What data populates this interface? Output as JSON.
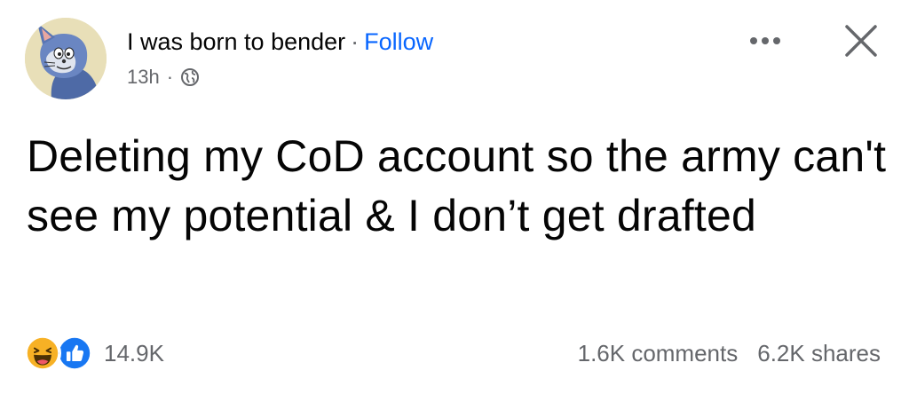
{
  "post": {
    "author": {
      "name": "I was born to bender",
      "separator": "·",
      "follow_label": "Follow",
      "avatar_icon": "cartoon-cat-avatar"
    },
    "meta": {
      "timestamp": "13h",
      "dot": "·",
      "privacy_icon": "globe-icon"
    },
    "actions": {
      "more_icon": "more-horizontal-icon",
      "close_icon": "close-icon"
    },
    "text": "Deleting my CoD account so the army can't see my potential & I don’t get drafted",
    "footer": {
      "reaction_icons": [
        "haha-icon",
        "like-icon"
      ],
      "reaction_count": "14.9K",
      "comments": "1.6K comments",
      "shares": "6.2K shares"
    },
    "colors": {
      "follow": "#0866ff",
      "secondary_text": "#65676b",
      "primary_text": "#050505",
      "like": "#1877f2",
      "haha": "#f7b125"
    }
  }
}
